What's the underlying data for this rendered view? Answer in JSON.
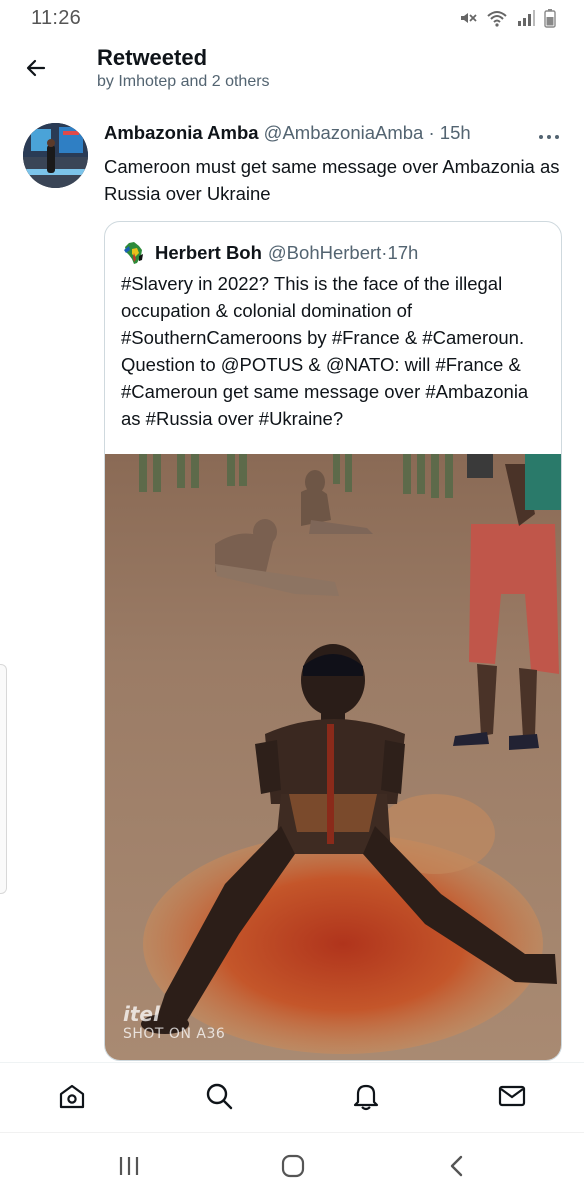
{
  "status_bar": {
    "time": "11:26",
    "icons": [
      "mute-icon",
      "wifi-icon",
      "signal-icon",
      "battery-icon"
    ]
  },
  "header": {
    "title": "Retweeted",
    "subtitle": "by Imhotep and 2 others",
    "back_icon": "arrow-left-icon"
  },
  "tweet": {
    "name": "Ambazonia Amba",
    "handle": "@AmbazoniaAmba",
    "separator": " · ",
    "time": "15h",
    "text": "Cameroon must get same message over Ambazonia as Russia over Ukraine",
    "more_icon": "more-horizontal-icon"
  },
  "quote": {
    "name": "Herbert Boh",
    "handle": "@BohHerbert",
    "separator": " · ",
    "time": "17h",
    "text": "#Slavery in 2022? This is the face of the illegal occupation & colonial domination of #SouthernCameroons by #France & #Cameroun. Question to @POTUS & @NATO: will #France & #Cameroun get same message over #Ambazonia as #Russia over #Ukraine?",
    "media_watermark_brand": "itel",
    "media_watermark_text": "SHOT ON A36"
  },
  "bottom_nav": {
    "items": [
      "home-icon",
      "search-icon",
      "notifications-icon",
      "messages-icon"
    ]
  },
  "system_nav": {
    "items": [
      "recents-icon",
      "home-circle-icon",
      "back-chevron-icon"
    ]
  },
  "colors": {
    "text_primary": "#0f1419",
    "text_secondary": "#536471",
    "border": "#cfd9de"
  }
}
